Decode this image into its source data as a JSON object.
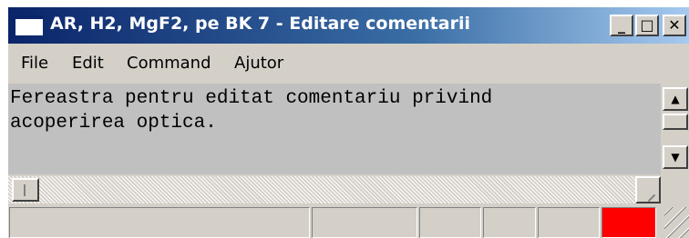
{
  "window": {
    "title": "AR, H2, MgF2, pe BK 7 - Editare comentarii",
    "controls": {
      "minimize": "_",
      "maximize": "□",
      "close": "✕"
    }
  },
  "menu": [
    {
      "label": "File"
    },
    {
      "label": "Edit"
    },
    {
      "label": "Command"
    },
    {
      "label": "Ajutor"
    }
  ],
  "editor": {
    "lines": [
      "Fereastra pentru editat comentariu privind",
      "acoperirea optica."
    ]
  },
  "scrollbar": {
    "up_arrow": "▲",
    "down_arrow": "▼"
  },
  "statusbar": {
    "indicator_color": "#ff0000"
  },
  "colors": {
    "titlebar_start": "#0a246a",
    "titlebar_end": "#a6caf0",
    "face": "#d4d0c8",
    "editor_bg": "#c0c0c0"
  }
}
